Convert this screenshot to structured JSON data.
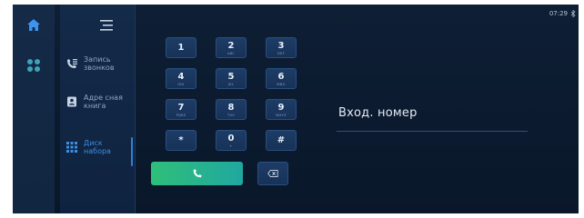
{
  "status_bar": {
    "time": "07:29"
  },
  "left_rail": {
    "items": [
      {
        "icon": "home-icon",
        "active": true
      },
      {
        "icon": "apps-icon",
        "active": false
      }
    ]
  },
  "menu": {
    "items": [
      {
        "icon": "call-log-icon",
        "label": "Запись звонков",
        "active": false
      },
      {
        "icon": "contacts-book-icon",
        "label": "Адре сная книга",
        "active": false
      },
      {
        "icon": "dialpad-icon",
        "label": "Диск набора",
        "active": true
      }
    ]
  },
  "keypad": {
    "keys": [
      {
        "digit": "1",
        "letters": ""
      },
      {
        "digit": "2",
        "letters": "ABC"
      },
      {
        "digit": "3",
        "letters": "DEF"
      },
      {
        "digit": "4",
        "letters": "GHI"
      },
      {
        "digit": "5",
        "letters": "JKL"
      },
      {
        "digit": "6",
        "letters": "MNO"
      },
      {
        "digit": "7",
        "letters": "PQRS"
      },
      {
        "digit": "8",
        "letters": "TUV"
      },
      {
        "digit": "9",
        "letters": "WXYZ"
      },
      {
        "digit": "*",
        "letters": ""
      },
      {
        "digit": "0",
        "letters": "+"
      },
      {
        "digit": "#",
        "letters": ""
      }
    ]
  },
  "number_field": {
    "placeholder": "Вход. номер",
    "value": ""
  },
  "colors": {
    "accent": "#2f7fd8",
    "call_green": "#2fbf7a"
  }
}
